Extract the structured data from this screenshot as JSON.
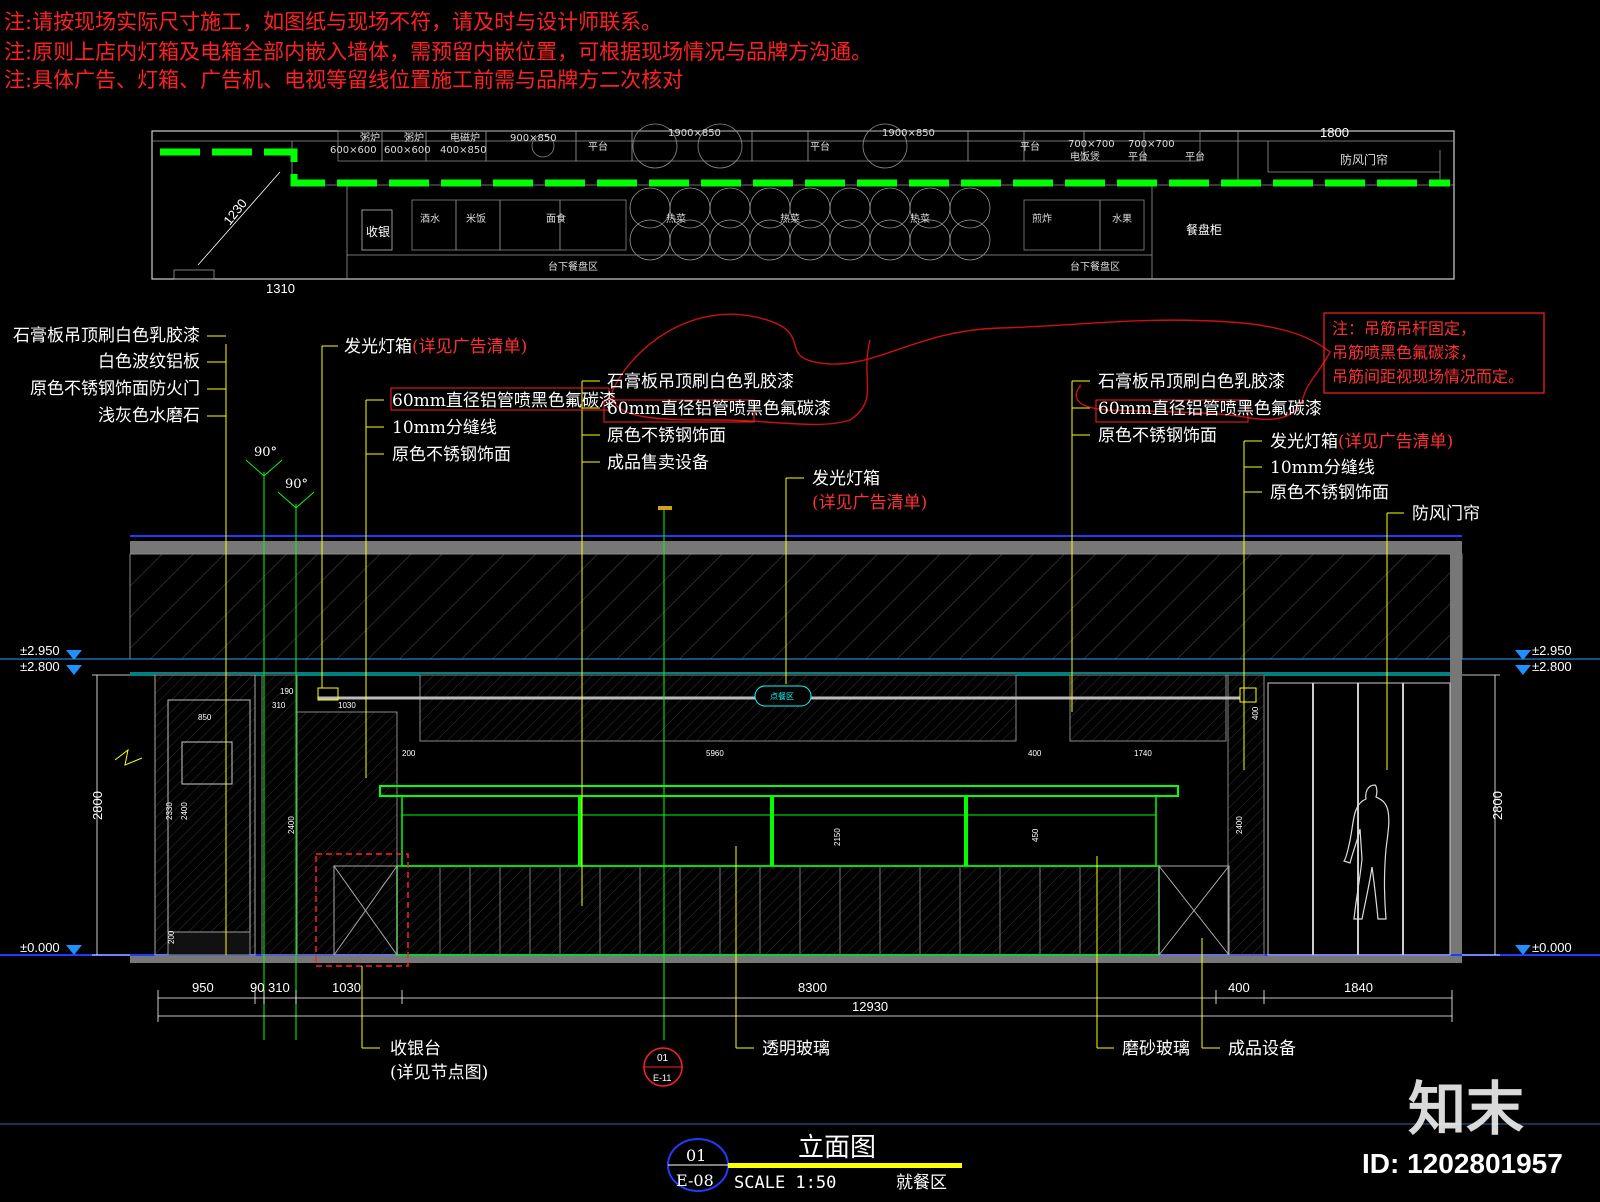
{
  "notes": [
    "注:请按现场实际尺寸施工，如图纸与现场不符，请及时与设计师联系。",
    "注:原则上店内灯箱及电箱全部内嵌入墙体，需预留内嵌位置，可根据现场情况与品牌方沟通。",
    "注:具体广告、灯箱、广告机、电视等留线位置施工前需与品牌方二次核对"
  ],
  "plan": {
    "top_labels": [
      "粥炉",
      "粥炉",
      "电磁炉",
      "平台",
      "平台",
      "平台",
      "电饭煲",
      "平台",
      "平台"
    ],
    "top_sizes": [
      "600×600",
      "600×600",
      "400×850",
      "900×850",
      "1900×850",
      "1900×850",
      "700×700",
      "700×700"
    ],
    "counter_labels": [
      "收银",
      "酒水",
      "米饭",
      "面食",
      "热菜",
      "热菜",
      "热菜",
      "煎炸",
      "水果",
      "餐盘柜"
    ],
    "under_labels": [
      "台下餐盘区",
      "台下餐盘区"
    ],
    "dims": [
      "1230",
      "1310",
      "1800"
    ],
    "door_curtain": "防风门帘"
  },
  "left_labels": [
    "石膏板吊顶刷白色乳胶漆",
    "白色波纹铝板",
    "原色不锈钢饰面防火门",
    "浅灰色水磨石"
  ],
  "angles": [
    "90°",
    "90°"
  ],
  "callouts": {
    "lightbox1": "发光灯箱",
    "lightbox1_note": "(详见广告清单)",
    "pipe1": "60mm直径铝管喷黑色氟碳漆",
    "seam1": "10mm分缝线",
    "steel1": "原色不锈钢饰面",
    "ceiling2": "石膏板吊顶刷白色乳胶漆",
    "pipe2": "60mm直径铝管喷黑色氟碳漆",
    "steel2": "原色不锈钢饰面",
    "equip1": "成品售卖设备",
    "lightbox2": "发光灯箱",
    "lightbox2_note": "(详见广告清单)",
    "ceiling3": "石膏板吊顶刷白色乳胶漆",
    "pipe3": "60mm直径铝管喷黑色氟碳漆",
    "steel3": "原色不锈钢饰面",
    "lightbox3": "发光灯箱",
    "lightbox3_note": "(详见广告清单)",
    "seam3": "10mm分缝线",
    "steel4": "原色不锈钢饰面",
    "curtain": "防风门帘"
  },
  "red_note": [
    "注：吊筋吊杆固定，",
    "吊筋喷黑色氟碳漆，",
    "吊筋间距视现场情况而定。"
  ],
  "levels": [
    "±2.950",
    "±2.800",
    "±0.000"
  ],
  "height_dim": "2800",
  "inner_dims": [
    "850",
    "310",
    "190",
    "1030",
    "2330",
    "2400",
    "2400",
    "200",
    "200",
    "5960",
    "400",
    "1740",
    "450",
    "2150",
    "400",
    "2400"
  ],
  "sign_text": "点餐区",
  "bottom_dims": [
    "950",
    "90",
    "310",
    "1030",
    "8300",
    "400",
    "1840",
    "12930"
  ],
  "bottom_labels": {
    "cashier": "收银台",
    "cashier_note": "(详见节点图)",
    "glass_clear": "透明玻璃",
    "glass_frosted": "磨砂玻璃",
    "equip": "成品设备"
  },
  "section_mark": {
    "num": "01",
    "ref": "E-11"
  },
  "title_block": {
    "num": "01",
    "sheet": "E-08",
    "title": "立面图",
    "scale": "SCALE 1:50",
    "area": "就餐区"
  },
  "watermark": {
    "logo": "知末",
    "id": "ID: 1202801957"
  },
  "colors": {
    "green": "#00ff00",
    "yellow": "#ffff00",
    "red": "#ff2020",
    "cyan": "#00ffff",
    "blue": "#1e3cff",
    "level": "#1e90ff"
  }
}
